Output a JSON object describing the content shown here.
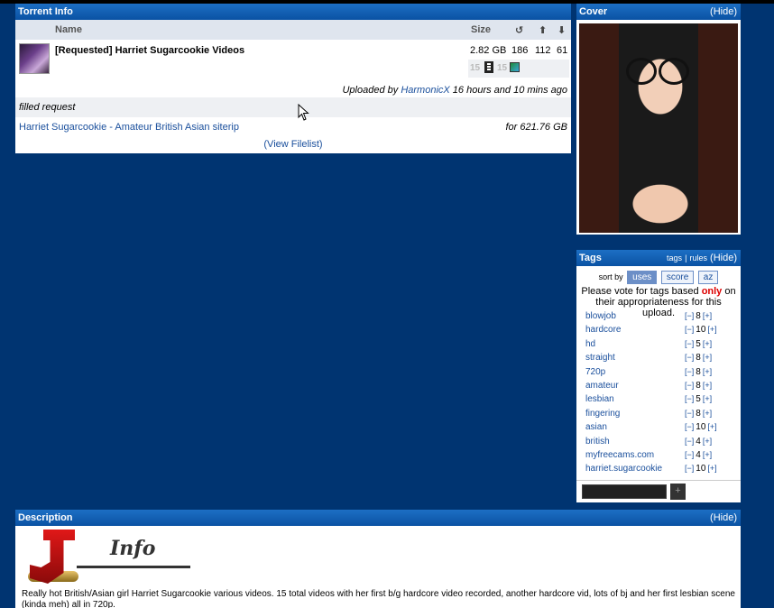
{
  "torrent_info": {
    "title": "Torrent Info",
    "columns": {
      "name": "Name",
      "size": "Size"
    },
    "column_icons": [
      "refresh-icon",
      "up-arrow-icon",
      "down-arrow-icon"
    ],
    "torrent": {
      "name": "[Requested] Harriet Sugarcookie Videos",
      "size": "2.82 GB",
      "snatches": "186",
      "seeders": "112",
      "leechers": "61",
      "format_a": "15",
      "format_b": "15"
    },
    "uploaded_prefix": "Uploaded by",
    "uploader": "HarmonicX",
    "uploaded_suffix": "16 hours and 10 mins ago",
    "filled_label": "filled request",
    "request_link": "Harriet Sugarcookie - Amateur British Asian siterip",
    "request_bounty": "for 621.76 GB",
    "view_filelist": "(View Filelist)"
  },
  "cover": {
    "title": "Cover",
    "hide": "(Hide)"
  },
  "tags": {
    "title": "Tags",
    "links": {
      "tags": "tags",
      "sep": "|",
      "rules": "rules"
    },
    "hide": "(Hide)",
    "sort_by": "sort by",
    "sort_options": [
      "uses",
      "score",
      "az"
    ],
    "note_before": "Please vote for tags based",
    "note_emph": "only",
    "note_after": "on their appropriateness for this upload.",
    "minus": "[−]",
    "plus": "[+]",
    "add_label": "+",
    "items": [
      {
        "name": "blowjob",
        "count": "8"
      },
      {
        "name": "hardcore",
        "count": "10"
      },
      {
        "name": "hd",
        "count": "5"
      },
      {
        "name": "straight",
        "count": "8"
      },
      {
        "name": "720p",
        "count": "8"
      },
      {
        "name": "amateur",
        "count": "8"
      },
      {
        "name": "lesbian",
        "count": "5"
      },
      {
        "name": "fingering",
        "count": "8"
      },
      {
        "name": "asian",
        "count": "10"
      },
      {
        "name": "british",
        "count": "4"
      },
      {
        "name": "myfreecams.com",
        "count": "4"
      },
      {
        "name": "harriet.sugarcookie",
        "count": "10"
      }
    ]
  },
  "description": {
    "title": "Description",
    "hide": "(Hide)",
    "logo_text": "Info",
    "text": "Really hot British/Asian girl Harriet Sugarcookie various videos. 15 total videos with her first b/g hardcore video recorded, another hardcore vid, lots of bj and her first lesbian scene (kinda meh) all in 720p."
  },
  "colors": {
    "page_bg": "#003471",
    "header": "#0a52a3",
    "link": "#1a4f9c",
    "emphasis": "#dd0000"
  }
}
